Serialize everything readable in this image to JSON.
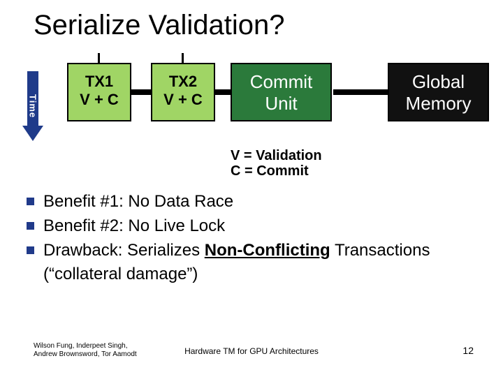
{
  "title": "Serialize Validation?",
  "time_label": "Time",
  "boxes": {
    "tx1": {
      "line1": "TX1",
      "line2": "V + C"
    },
    "tx2": {
      "line1": "TX2",
      "line2": "V + C"
    },
    "commit": {
      "line1": "Commit",
      "line2": "Unit"
    },
    "global": {
      "line1": "Global",
      "line2": "Memory"
    }
  },
  "legend": {
    "line1": "V = Validation",
    "line2": "C = Commit"
  },
  "bullets": {
    "b1": "Benefit #1: No Data Race",
    "b2": "Benefit #2: No Live Lock",
    "b3_pre": "Drawback: Serializes ",
    "b3_underline": "Non-Conflicting",
    "b3_post": " Transactions (“collateral damage”)"
  },
  "footer": {
    "authors_line1": "Wilson Fung, Inderpeet Singh,",
    "authors_line2": "Andrew Brownsword, Tor Aamodt",
    "center": "Hardware TM for GPU Architectures",
    "page": "12"
  }
}
